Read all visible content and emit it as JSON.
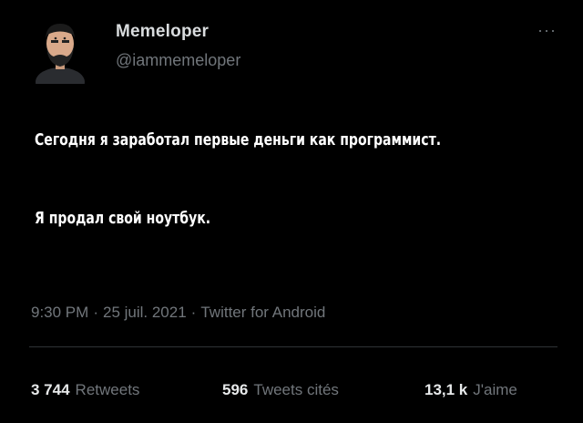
{
  "author": {
    "name": "Memeloper",
    "handle": "@iammemeloper"
  },
  "more_icon": "more-horizontal-icon",
  "tweet": {
    "lines": [
      "Сегодня я заработал первые деньги как программист.",
      "Я продал свой ноутбук."
    ]
  },
  "meta": {
    "time": "9:30 PM",
    "date": "25 juil. 2021",
    "source": "Twitter for Android",
    "separator": "·"
  },
  "stats": {
    "retweets": {
      "count": "3 744",
      "label": "Retweets"
    },
    "quotes": {
      "count": "596",
      "label": "Tweets cités"
    },
    "likes": {
      "count": "13,1 k",
      "label": "J'aime"
    }
  },
  "colors": {
    "background": "#000000",
    "text": "#e7e9ea",
    "muted": "#71767b"
  }
}
